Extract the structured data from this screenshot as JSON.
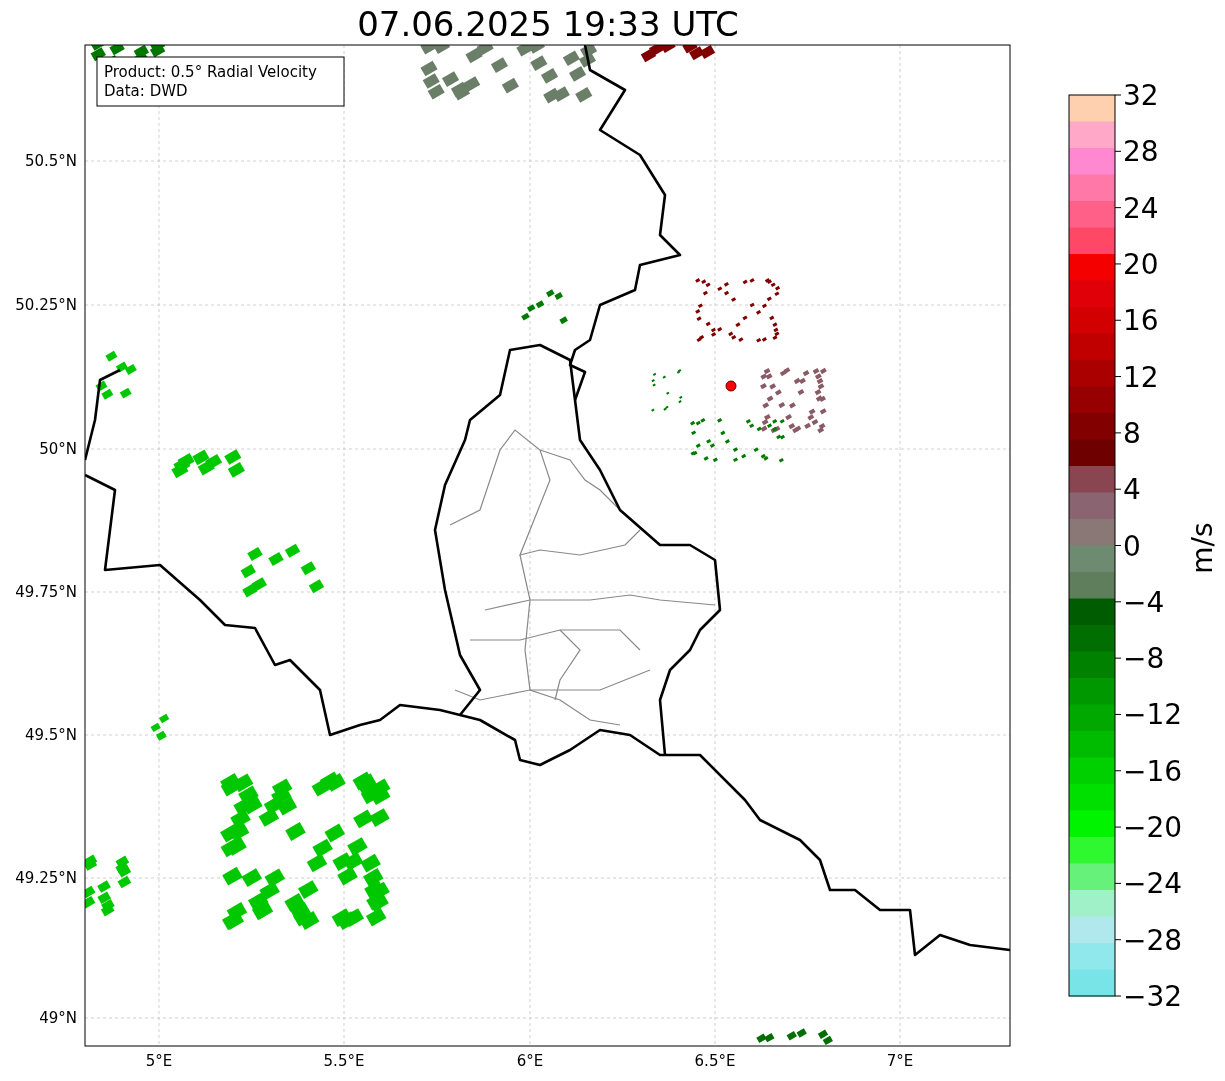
{
  "title": "07.06.2025 19:33 UTC",
  "legend": [
    "Product: 0.5° Radial Velocity",
    "Data: DWD"
  ],
  "map": {
    "x_ticks": [
      "5°E",
      "5.5°E",
      "6°E",
      "6.5°E",
      "7°E"
    ],
    "y_ticks": [
      "50.5°N",
      "50.25°N",
      "50°N",
      "49.75°N",
      "49.5°N",
      "49.25°N",
      "49°N"
    ]
  },
  "colorbar": {
    "label": "m/s",
    "ticks": [
      "32",
      "28",
      "24",
      "20",
      "16",
      "12",
      "8",
      "4",
      "0",
      "−4",
      "−8",
      "−12",
      "−16",
      "−20",
      "−24",
      "−28",
      "−32"
    ],
    "bins": [
      {
        "color": "#ffd0b0"
      },
      {
        "color": "#ffa8c8"
      },
      {
        "color": "#ff88d0"
      },
      {
        "color": "#ff78a8"
      },
      {
        "color": "#ff6088"
      },
      {
        "color": "#ff4866"
      },
      {
        "color": "#f50000"
      },
      {
        "color": "#e00008"
      },
      {
        "color": "#d20000"
      },
      {
        "color": "#c00000"
      },
      {
        "color": "#aa0000"
      },
      {
        "color": "#960000"
      },
      {
        "color": "#820000"
      },
      {
        "color": "#6e0000"
      },
      {
        "color": "#8a4650"
      },
      {
        "color": "#8a6470"
      },
      {
        "color": "#8a7876"
      },
      {
        "color": "#6e8a70"
      },
      {
        "color": "#5e7e5c"
      },
      {
        "color": "#005c00"
      },
      {
        "color": "#006e00"
      },
      {
        "color": "#008200"
      },
      {
        "color": "#009800"
      },
      {
        "color": "#00a800"
      },
      {
        "color": "#00bc00"
      },
      {
        "color": "#00d000"
      },
      {
        "color": "#00e000"
      },
      {
        "color": "#00f400"
      },
      {
        "color": "#30f830"
      },
      {
        "color": "#66f27a"
      },
      {
        "color": "#a0f0c8"
      },
      {
        "color": "#b0e8ee"
      },
      {
        "color": "#90e8ec"
      },
      {
        "color": "#78e4e8"
      }
    ]
  }
}
